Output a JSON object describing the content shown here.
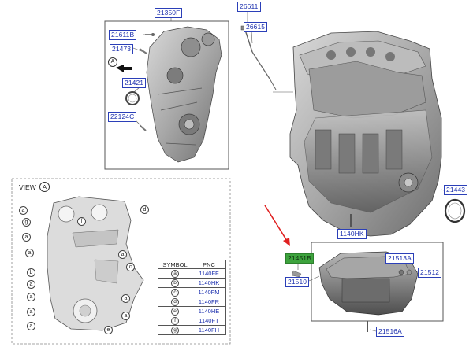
{
  "parts": {
    "timing_cover": "21350F",
    "bolt_21611b": "21611B",
    "dowel": "21473",
    "seal": "21421",
    "plug": "22124C",
    "dipstick_tube": "26611",
    "dipstick": "26615",
    "rear_seal": "21443",
    "bolt_1140hk": "1140HK",
    "highlighted_part": "21451B",
    "oil_pan": "21510",
    "drain_plug": "21513A",
    "gasket": "21512",
    "oil_pan_bolt": "21516A"
  },
  "view": {
    "title": "VIEW",
    "marker": "A"
  },
  "legend": {
    "header_symbol": "SYMBOL",
    "header_pnc": "PNC",
    "rows": [
      {
        "symbol": "a",
        "pnc": "1140FF"
      },
      {
        "symbol": "b",
        "pnc": "1140HK"
      },
      {
        "symbol": "c",
        "pnc": "1140FM"
      },
      {
        "symbol": "d",
        "pnc": "1140FR"
      },
      {
        "symbol": "e",
        "pnc": "1140HE"
      },
      {
        "symbol": "f",
        "pnc": "1140FT"
      },
      {
        "symbol": "g",
        "pnc": "1140FH"
      }
    ]
  },
  "symbols": {
    "a": "a",
    "b": "b",
    "c": "c",
    "d": "d",
    "e": "e",
    "f": "f",
    "g": "g"
  },
  "colors": {
    "label_border": "#2b3fb8",
    "highlight": "#3da33d",
    "arrow": "#e02020"
  }
}
